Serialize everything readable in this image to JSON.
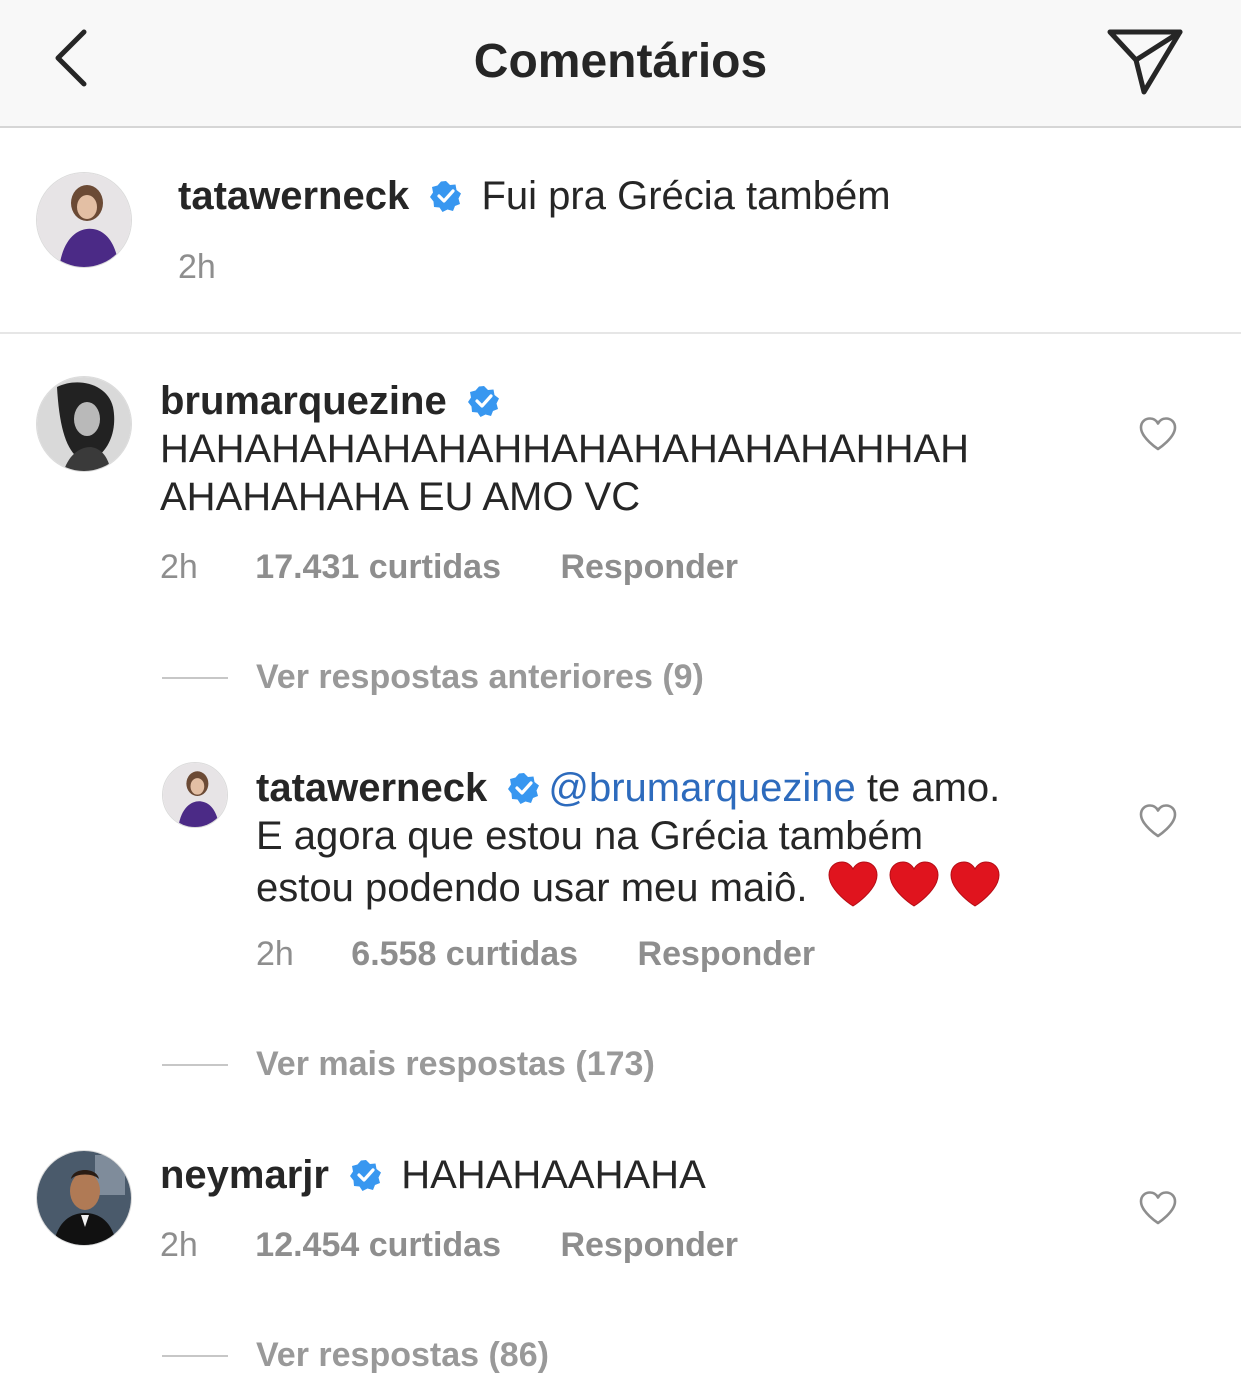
{
  "header": {
    "title": "Comentários"
  },
  "caption": {
    "username": "tatawerneck",
    "text": "Fui pra Grécia também",
    "time": "2h"
  },
  "comments": [
    {
      "username": "brumarquezine",
      "text_line1": "HAHAHAHAHAHAHHAHAHAHAHAHAHHAH",
      "text_line2": "AHAHAHAHA EU AMO VC",
      "time": "2h",
      "likes": "17.431 curtidas",
      "reply": "Responder",
      "more": "Ver respostas anteriores (9)"
    },
    {
      "username": "tatawerneck",
      "mention": "@brumarquezine",
      "text_line1_rest": " te amo.",
      "text_line2": "E agora que estou na Grécia também",
      "text_line3": "estou podendo usar meu maiô.",
      "time": "2h",
      "likes": "6.558 curtidas",
      "reply": "Responder",
      "more": "Ver mais respostas (173)"
    },
    {
      "username": "neymarjr",
      "text": "HAHAHAAHAHA",
      "time": "2h",
      "likes": "12.454 curtidas",
      "reply": "Responder",
      "more": "Ver respostas (86)"
    }
  ],
  "colors": {
    "verified": "#3897f0",
    "heart_emoji": "#e0141e",
    "meta_text": "#8e8e8e"
  }
}
